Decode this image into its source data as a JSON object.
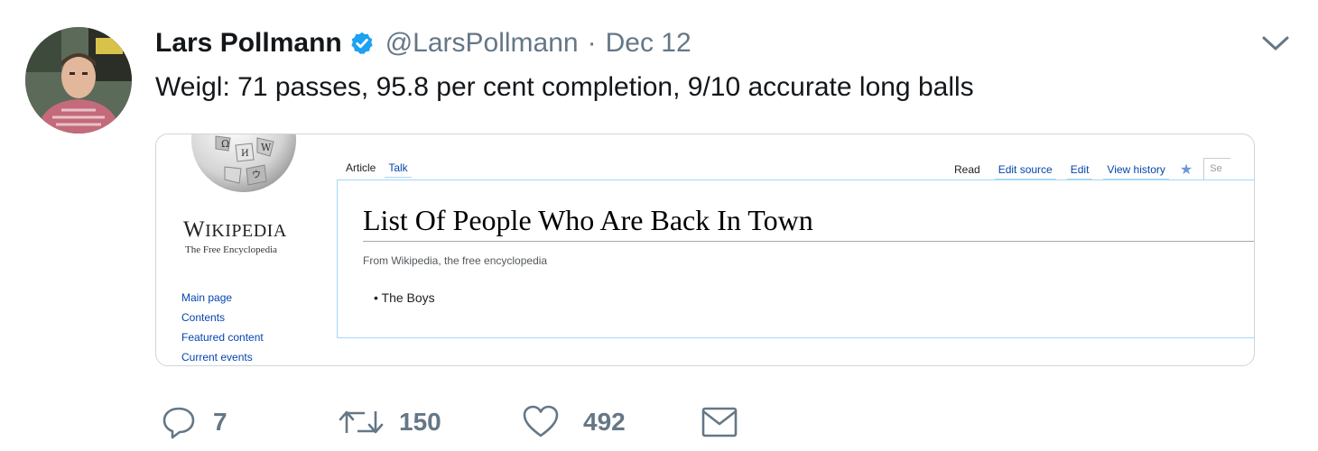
{
  "tweet": {
    "author_name": "Lars Pollmann",
    "handle": "@LarsPollmann",
    "separator": "·",
    "date": "Dec 12",
    "text": "Weigl: 71 passes, 95.8 per cent completion, 9/10 accurate long balls",
    "verified": true
  },
  "card": {
    "wordmark_big": "W",
    "wordmark_rest": "IKIPEDIA",
    "wordmark_end": "A",
    "tagline": "The Free Encyclopedia",
    "nav": [
      "Main page",
      "Contents",
      "Featured content",
      "Current events"
    ],
    "tabs_left": [
      "Article",
      "Talk"
    ],
    "tabs_right": [
      "Read",
      "Edit source",
      "Edit",
      "View history"
    ],
    "search_placeholder": "Se",
    "article_title": "List Of People Who Are Back In Town",
    "from_line": "From Wikipedia, the free encyclopedia",
    "bullets": [
      "The Boys"
    ]
  },
  "actions": {
    "replies": "7",
    "retweets": "150",
    "likes": "492"
  },
  "colors": {
    "verified_blue": "#1da1f2",
    "secondary_text": "#657786",
    "wiki_link": "#0645ad"
  },
  "icons": {
    "reply": "speech-bubble",
    "retweet": "retweet-arrows",
    "like": "heart-outline",
    "dm": "envelope",
    "menu": "chevron-down"
  }
}
